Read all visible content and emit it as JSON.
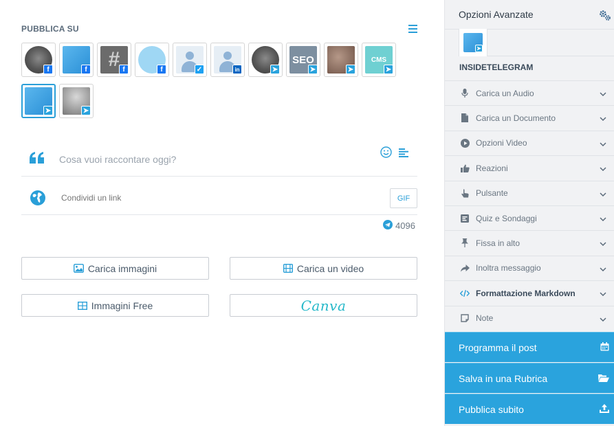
{
  "publish": {
    "title": "PUBBLICA SU",
    "accounts": [
      {
        "label": "",
        "network": "facebook",
        "style": "dark"
      },
      {
        "label": "",
        "network": "facebook",
        "style": "blue"
      },
      {
        "label": "#",
        "network": "facebook",
        "style": "hash"
      },
      {
        "label": "",
        "network": "facebook",
        "style": "light"
      },
      {
        "label": "",
        "network": "twitter",
        "style": "user"
      },
      {
        "label": "",
        "network": "linkedin",
        "style": "user"
      },
      {
        "label": "",
        "network": "telegram",
        "style": "dark"
      },
      {
        "label": "SEO",
        "network": "telegram",
        "style": "seo"
      },
      {
        "label": "",
        "network": "telegram",
        "style": "photo"
      },
      {
        "label": "CMS",
        "network": "telegram",
        "style": "cms"
      },
      {
        "label": "",
        "network": "telegram",
        "style": "blue",
        "selected": true
      },
      {
        "label": "",
        "network": "telegram",
        "style": "man"
      }
    ]
  },
  "editor": {
    "placeholder": "Cosa vuoi raccontare oggi?",
    "link_placeholder": "Condividi un link",
    "gif_label": "GIF",
    "char_count": "4096"
  },
  "buttons": {
    "upload_images": "Carica immagini",
    "upload_video": "Carica un video",
    "free_images": "Immagini Free",
    "canva": "Canva"
  },
  "sidebar": {
    "title": "Opzioni Avanzate",
    "channel_name": "INSIDETELEGRAM",
    "options": [
      {
        "label": "Carica un Audio",
        "icon": "microphone-icon"
      },
      {
        "label": "Carica un Documento",
        "icon": "document-icon"
      },
      {
        "label": "Opzioni Video",
        "icon": "play-icon"
      },
      {
        "label": "Reazioni",
        "icon": "thumbs-up-icon"
      },
      {
        "label": "Pulsante",
        "icon": "pointer-icon"
      },
      {
        "label": "Quiz e Sondaggi",
        "icon": "poll-icon"
      },
      {
        "label": "Fissa in alto",
        "icon": "pin-icon"
      },
      {
        "label": "Inoltra messaggio",
        "icon": "share-icon"
      },
      {
        "label": "Formattazione Markdown",
        "icon": "code-icon",
        "active": true
      },
      {
        "label": "Note",
        "icon": "note-icon"
      }
    ],
    "actions": [
      {
        "label": "Programma il post",
        "icon": "calendar-icon"
      },
      {
        "label": "Salva in una Rubrica",
        "icon": "folder-open-icon"
      },
      {
        "label": "Pubblica subito",
        "icon": "upload-icon"
      }
    ]
  },
  "colors": {
    "accent": "#2aa3dd",
    "panel": "#f1f2f4",
    "text": "#6a7682"
  }
}
